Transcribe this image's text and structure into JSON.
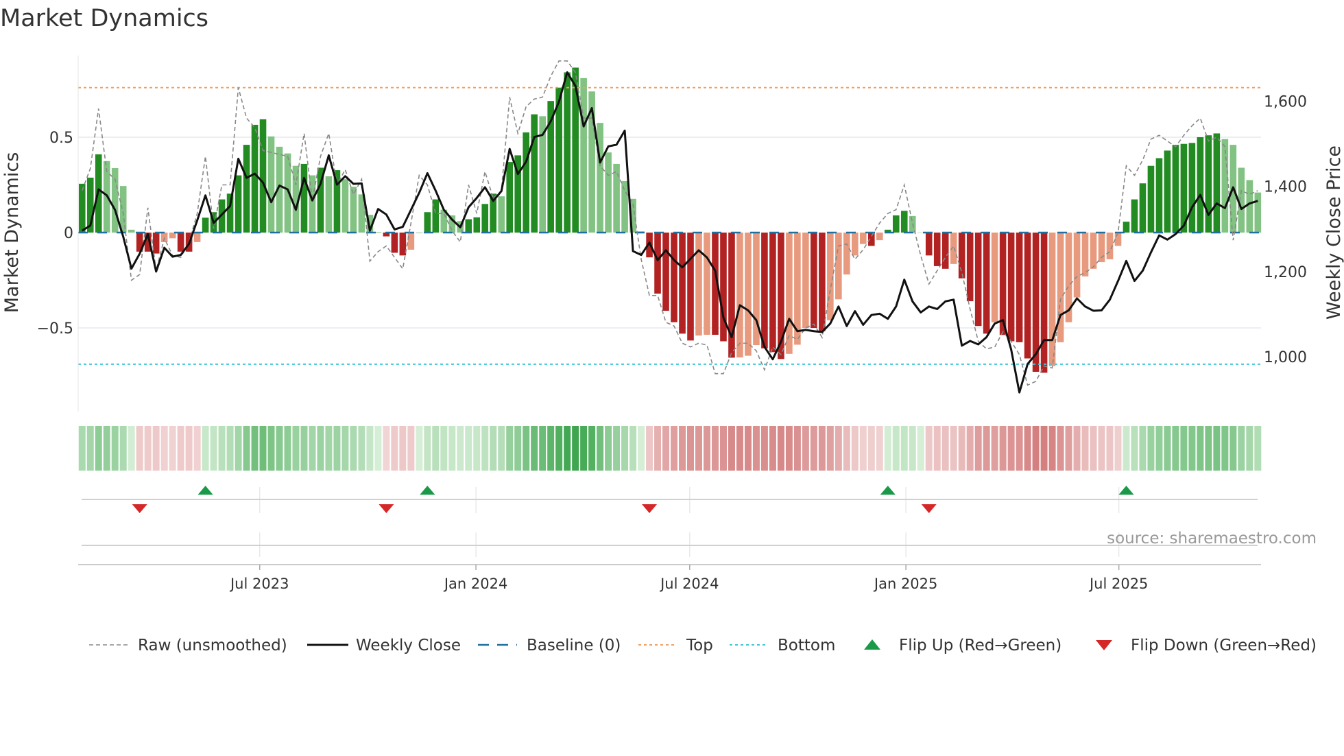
{
  "title": "Market Dynamics",
  "source": "source: sharemaestro.com",
  "colors": {
    "dark_green": "#228b22",
    "light_green": "#82c282",
    "dark_red": "#b22222",
    "light_red": "#e89a7e",
    "price_line": "#111111",
    "raw_line": "#888888",
    "baseline": "#1f6f9f",
    "top": "#f0a060",
    "bottom": "#40c8d8",
    "flip_up": "#1a9a48",
    "flip_down": "#d62728",
    "heat_pos_low": "#d6eed6",
    "heat_pos_high": "#3ea64e",
    "heat_neg_low": "#f2d6d6",
    "heat_neg_high": "#cf7070",
    "grid": "#e6e9ef"
  },
  "chart_data": {
    "type": "bar",
    "title": "Market Dynamics",
    "left_axis": {
      "label": "Market Dynamics",
      "ylim": [
        -0.94,
        0.93
      ],
      "ticks": [
        0.5,
        0,
        -0.5
      ],
      "tick_labels": [
        "0.5",
        "0",
        "−0.5"
      ]
    },
    "right_axis": {
      "label": "Weekly Close Price",
      "ticks": [
        1000,
        1200,
        1400,
        1600
      ],
      "tick_labels": [
        "1,000",
        "1,200",
        "1,400",
        "1,600"
      ]
    },
    "x_axis": {
      "tick_labels": [
        "Jul 2023",
        "Jan 2024",
        "Jul 2024",
        "Jan 2025",
        "Jul 2025"
      ],
      "tick_week_index": [
        21.6,
        47.9,
        73.9,
        100.2,
        126.1
      ]
    },
    "levels": {
      "top": 0.76,
      "bottom": -0.69,
      "baseline": 0
    },
    "dynamics": [
      0.256,
      0.288,
      0.41,
      0.375,
      0.338,
      0.244,
      0.015,
      -0.1,
      -0.1,
      -0.11,
      -0.05,
      -0.03,
      -0.1,
      -0.1,
      -0.05,
      0.078,
      0.107,
      0.174,
      0.204,
      0.3,
      0.46,
      0.565,
      0.594,
      0.504,
      0.45,
      0.415,
      0.35,
      0.36,
      0.3,
      0.34,
      0.295,
      0.327,
      0.28,
      0.24,
      0.2,
      0.093,
      0.003,
      -0.02,
      -0.106,
      -0.12,
      -0.09,
      0.0,
      0.107,
      0.174,
      0.12,
      0.09,
      0.06,
      0.07,
      0.08,
      0.15,
      0.204,
      0.19,
      0.37,
      0.405,
      0.525,
      0.62,
      0.61,
      0.69,
      0.76,
      0.84,
      0.865,
      0.81,
      0.74,
      0.575,
      0.42,
      0.36,
      0.27,
      0.177,
      0.006,
      -0.13,
      -0.32,
      -0.41,
      -0.47,
      -0.53,
      -0.566,
      -0.54,
      -0.536,
      -0.536,
      -0.57,
      -0.656,
      -0.655,
      -0.646,
      -0.59,
      -0.607,
      -0.627,
      -0.663,
      -0.636,
      -0.588,
      -0.5,
      -0.5,
      -0.517,
      -0.46,
      -0.35,
      -0.22,
      -0.12,
      -0.06,
      -0.07,
      -0.04,
      0.015,
      0.09,
      0.114,
      0.087,
      0.0,
      -0.12,
      -0.176,
      -0.19,
      -0.165,
      -0.24,
      -0.36,
      -0.49,
      -0.53,
      -0.47,
      -0.537,
      -0.57,
      -0.575,
      -0.66,
      -0.73,
      -0.735,
      -0.7,
      -0.575,
      -0.47,
      -0.34,
      -0.23,
      -0.19,
      -0.155,
      -0.14,
      -0.07,
      0.057,
      0.174,
      0.258,
      0.35,
      0.39,
      0.43,
      0.46,
      0.465,
      0.47,
      0.5,
      0.51,
      0.52,
      0.49,
      0.46,
      0.34,
      0.275,
      0.21
    ],
    "raw": [
      0.22,
      0.336,
      0.65,
      0.32,
      0.28,
      0.1,
      -0.25,
      -0.22,
      0.13,
      -0.2,
      -0.03,
      -0.12,
      -0.13,
      -0.05,
      0.1,
      0.4,
      0.02,
      0.25,
      0.25,
      0.76,
      0.6,
      0.55,
      0.43,
      0.42,
      0.41,
      0.4,
      0.25,
      0.52,
      0.17,
      0.4,
      0.52,
      0.25,
      0.33,
      0.2,
      0.28,
      -0.15,
      -0.1,
      -0.07,
      -0.13,
      -0.19,
      0.05,
      0.3,
      0.25,
      0.1,
      0.1,
      0.01,
      -0.05,
      0.25,
      0.1,
      0.32,
      0.18,
      0.22,
      0.71,
      0.52,
      0.66,
      0.7,
      0.71,
      0.82,
      0.9,
      0.9,
      0.84,
      0.6,
      0.6,
      0.35,
      0.3,
      0.32,
      0.22,
      0.15,
      -0.14,
      -0.33,
      -0.33,
      -0.47,
      -0.49,
      -0.58,
      -0.6,
      -0.58,
      -0.59,
      -0.74,
      -0.74,
      -0.63,
      -0.58,
      -0.58,
      -0.62,
      -0.72,
      -0.6,
      -0.64,
      -0.54,
      -0.56,
      -0.5,
      -0.48,
      -0.55,
      -0.3,
      -0.07,
      -0.06,
      -0.14,
      -0.09,
      -0.02,
      0.05,
      0.1,
      0.12,
      0.25,
      0.05,
      -0.12,
      -0.27,
      -0.2,
      -0.13,
      -0.07,
      -0.21,
      -0.4,
      -0.57,
      -0.61,
      -0.6,
      -0.52,
      -0.57,
      -0.64,
      -0.8,
      -0.78,
      -0.7,
      -0.71,
      -0.35,
      -0.28,
      -0.23,
      -0.21,
      -0.18,
      -0.13,
      -0.1,
      0.0,
      0.35,
      0.3,
      0.38,
      0.49,
      0.51,
      0.48,
      0.45,
      0.51,
      0.56,
      0.6,
      0.48,
      0.5,
      0.45,
      -0.04,
      0.22,
      0.2,
      0.22
    ],
    "weekly_close": [
      1296,
      1308,
      1393,
      1379,
      1345,
      1282,
      1207,
      1242,
      1288,
      1200,
      1256,
      1235,
      1239,
      1265,
      1320,
      1379,
      1314,
      1334,
      1354,
      1465,
      1420,
      1430,
      1409,
      1363,
      1402,
      1393,
      1345,
      1420,
      1367,
      1406,
      1473,
      1404,
      1424,
      1406,
      1407,
      1296,
      1347,
      1334,
      1299,
      1305,
      1345,
      1385,
      1431,
      1390,
      1345,
      1322,
      1304,
      1351,
      1373,
      1398,
      1366,
      1389,
      1488,
      1429,
      1458,
      1516,
      1521,
      1553,
      1599,
      1668,
      1636,
      1541,
      1584,
      1456,
      1494,
      1498,
      1531,
      1248,
      1239,
      1268,
      1227,
      1250,
      1227,
      1210,
      1230,
      1250,
      1233,
      1202,
      1092,
      1046,
      1121,
      1109,
      1086,
      1023,
      994,
      1035,
      1089,
      1060,
      1063,
      1060,
      1058,
      1078,
      1118,
      1072,
      1107,
      1075,
      1098,
      1101,
      1089,
      1118,
      1181,
      1130,
      1104,
      1118,
      1112,
      1130,
      1134,
      1026,
      1037,
      1029,
      1046,
      1078,
      1086,
      1017,
      916,
      983,
      1006,
      1039,
      1039,
      1098,
      1109,
      1137,
      1118,
      1108,
      1109,
      1134,
      1178,
      1225,
      1178,
      1202,
      1245,
      1285,
      1275,
      1288,
      1308,
      1351,
      1380,
      1333,
      1360,
      1349,
      1398,
      1347,
      1360,
      1366
    ],
    "flip_up_weeks": [
      15,
      42,
      98,
      127
    ],
    "flip_down_weeks": [
      7,
      37,
      69,
      103
    ],
    "legend_position": "bottom",
    "legend": [
      {
        "label": "Raw (unsmoothed)",
        "kind": "raw"
      },
      {
        "label": "Weekly Close",
        "kind": "close"
      },
      {
        "label": "Baseline (0)",
        "kind": "baseline"
      },
      {
        "label": "Top",
        "kind": "top"
      },
      {
        "label": "Bottom",
        "kind": "bottom"
      },
      {
        "label": "Flip Up (Red→Green)",
        "kind": "up"
      },
      {
        "label": "Flip Down (Green→Red)",
        "kind": "down"
      }
    ]
  }
}
